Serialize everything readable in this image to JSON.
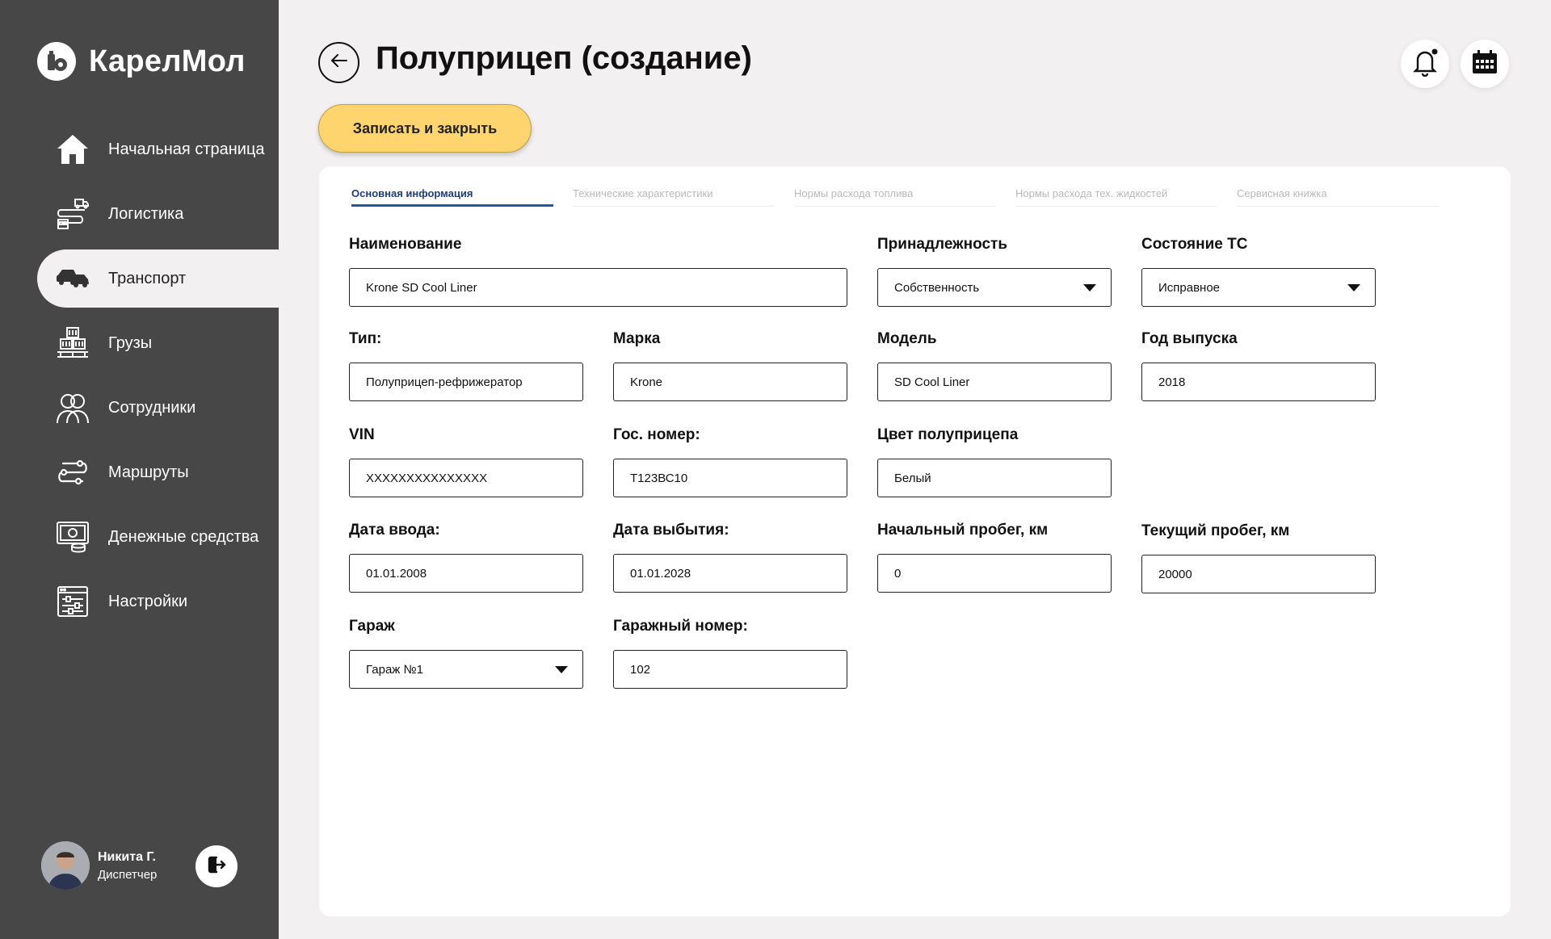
{
  "app": {
    "brand": "КарелМол"
  },
  "sidebar": {
    "items": [
      {
        "label": "Начальная страница",
        "icon": "home-icon"
      },
      {
        "label": "Логистика",
        "icon": "logistics-icon"
      },
      {
        "label": "Транспорт",
        "icon": "transport-icon",
        "active": true
      },
      {
        "label": "Грузы",
        "icon": "cargo-icon"
      },
      {
        "label": "Сотрудники",
        "icon": "employees-icon"
      },
      {
        "label": "Маршруты",
        "icon": "routes-icon"
      },
      {
        "label": "Денежные средства",
        "icon": "money-icon"
      },
      {
        "label": "Настройки",
        "icon": "settings-icon"
      }
    ]
  },
  "user": {
    "name": "Никита Г.",
    "role": "Диспетчер"
  },
  "header": {
    "title": "Полуприцеп (создание)",
    "save_label": "Записать и закрыть"
  },
  "tabs": [
    {
      "label": "Основная информация",
      "active": true
    },
    {
      "label": "Технические характеристики"
    },
    {
      "label": "Нормы расхода топлива"
    },
    {
      "label": "Нормы расхода тех. жидкостей"
    },
    {
      "label": "Сервисная книжка"
    }
  ],
  "form": {
    "name": {
      "label": "Наименование",
      "value": "Krone SD Cool Liner"
    },
    "ownership": {
      "label": "Принадлежность",
      "value": "Собственность"
    },
    "condition": {
      "label": "Состояние ТС",
      "value": "Исправное"
    },
    "type": {
      "label": "Тип:",
      "value": "Полуприцеп-рефрижератор"
    },
    "brand": {
      "label": "Марка",
      "value": "Krone"
    },
    "model": {
      "label": "Модель",
      "value": "SD Cool Liner"
    },
    "year": {
      "label": "Год выпуска",
      "value": "2018"
    },
    "vin": {
      "label": "VIN",
      "value": "XXXXXXXXXXXXXXX"
    },
    "plate": {
      "label": "Гос. номер:",
      "value": "Т123ВС10"
    },
    "color": {
      "label": "Цвет полуприцепа",
      "value": "Белый"
    },
    "date_in": {
      "label": "Дата ввода:",
      "value": "01.01.2008"
    },
    "date_out": {
      "label": "Дата выбытия:",
      "value": "01.01.2028"
    },
    "mileage_start": {
      "label": "Начальный пробег, км",
      "value": "0"
    },
    "mileage_current": {
      "label": "Текущий пробег, км",
      "value": "20000"
    },
    "garage": {
      "label": "Гараж",
      "value": "Гараж №1"
    },
    "garage_number": {
      "label": "Гаражный номер:",
      "value": "102"
    }
  },
  "colors": {
    "sidebar_bg": "#474747",
    "page_bg": "#f3f0f1",
    "accent": "#fdd46e",
    "tab_active": "#1f3e79"
  }
}
